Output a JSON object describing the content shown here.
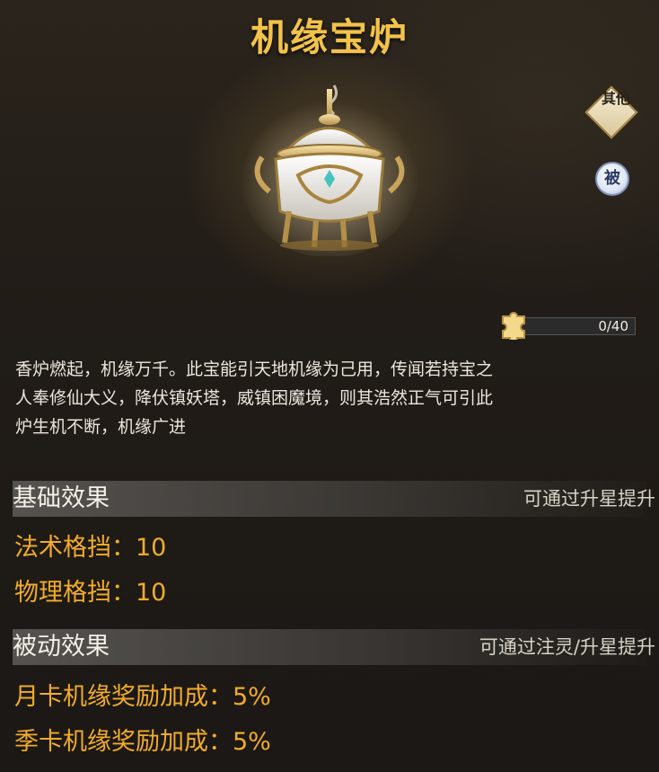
{
  "title": "机缘宝炉",
  "tags": {
    "other": "其他",
    "passive": "被"
  },
  "progress": {
    "text": "0/40",
    "fraction": 0
  },
  "description": {
    "lines": [
      "香炉燃起，机缘万千。此宝能引天地机缘为己用，传闻若持宝之",
      "人奉修仙大义，降伏镇妖塔，威镇困魔境，则其浩然正气可引此",
      "炉生机不断，机缘广进"
    ]
  },
  "basic": {
    "title": "基础效果",
    "hint": "可通过升星提升",
    "stats": [
      "法术格挡：10",
      "物理格挡：10"
    ]
  },
  "passive": {
    "title": "被动效果",
    "hint": "可通过注灵/升星提升",
    "stats": [
      "月卡机缘奖励加成：5%",
      "季卡机缘奖励加成：5%"
    ]
  },
  "colors": {
    "title": "#f2c24a",
    "stat": "#f2ac2a",
    "section_bar": "#585652"
  },
  "icons": [
    "incense-burner-icon",
    "other-tag-icon",
    "passive-tag-icon",
    "puzzle-piece-icon"
  ]
}
